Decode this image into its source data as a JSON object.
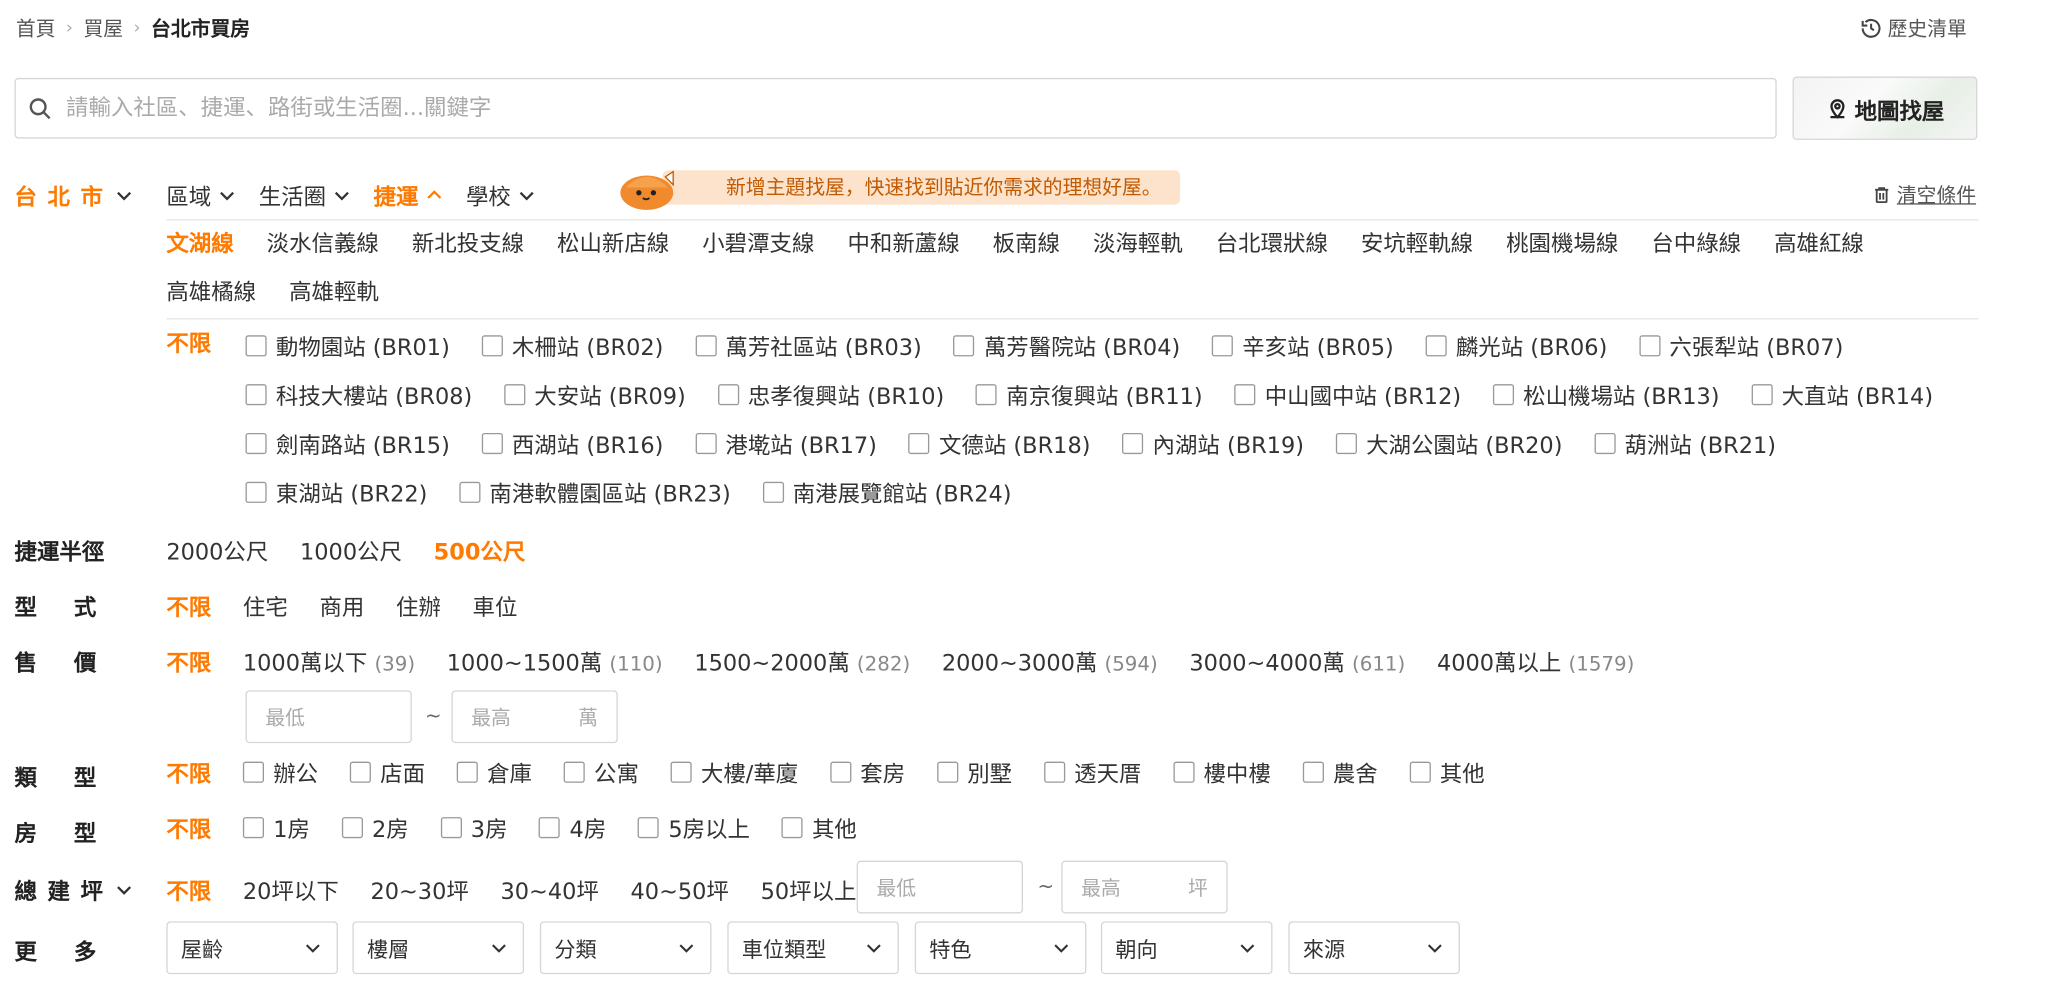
{
  "breadcrumb": {
    "home": "首頁",
    "buy": "買屋",
    "current": "台北市買房"
  },
  "history": {
    "label": "歷史清單"
  },
  "search": {
    "placeholder": "請輸入社區、捷運、路街或生活圈...關鍵字",
    "map_label": "地圖找屋"
  },
  "city": {
    "label": "台北市"
  },
  "tabs": [
    "區域",
    "生活圈",
    "捷運",
    "學校"
  ],
  "promo": {
    "text": "新增主題找屋，快速找到貼近你需求的理想好屋。"
  },
  "clear": {
    "label": "清空條件"
  },
  "lines": [
    "文湖線",
    "淡水信義線",
    "新北投支線",
    "松山新店線",
    "小碧潭支線",
    "中和新蘆線",
    "板南線",
    "淡海輕軌",
    "台北環狀線",
    "安坑輕軌線",
    "桃園機場線",
    "台中綠線",
    "高雄紅線",
    "高雄橘線",
    "高雄輕軌"
  ],
  "stations": {
    "unlimited": "不限",
    "items": [
      "動物園站 (BR01)",
      "木柵站 (BR02)",
      "萬芳社區站 (BR03)",
      "萬芳醫院站 (BR04)",
      "辛亥站 (BR05)",
      "麟光站 (BR06)",
      "六張犁站 (BR07)",
      "科技大樓站 (BR08)",
      "大安站 (BR09)",
      "忠孝復興站 (BR10)",
      "南京復興站 (BR11)",
      "中山國中站 (BR12)",
      "松山機場站 (BR13)",
      "大直站 (BR14)",
      "劍南路站 (BR15)",
      "西湖站 (BR16)",
      "港墘站 (BR17)",
      "文德站 (BR18)",
      "內湖站 (BR19)",
      "大湖公園站 (BR20)",
      "葫洲站 (BR21)",
      "東湖站 (BR22)",
      "南港軟體園區站 (BR23)",
      "南港展覽館站 (BR24)"
    ]
  },
  "radius": {
    "label": "捷運半徑",
    "options": [
      "2000公尺",
      "1000公尺",
      "500公尺"
    ]
  },
  "form": {
    "label": "型式",
    "options": [
      "不限",
      "住宅",
      "商用",
      "住辦",
      "車位"
    ]
  },
  "price": {
    "label": "售價",
    "unlimited": "不限",
    "options": [
      {
        "text": "1000萬以下",
        "count": "(39)"
      },
      {
        "text": "1000~1500萬",
        "count": "(110)"
      },
      {
        "text": "1500~2000萬",
        "count": "(282)"
      },
      {
        "text": "2000~3000萬",
        "count": "(594)"
      },
      {
        "text": "3000~4000萬",
        "count": "(611)"
      },
      {
        "text": "4000萬以上",
        "count": "(1579)"
      }
    ],
    "min_placeholder": "最低",
    "max_placeholder": "最高",
    "unit": "萬",
    "tilde": "~"
  },
  "kind": {
    "label": "類型",
    "unlimited": "不限",
    "options": [
      "辦公",
      "店面",
      "倉庫",
      "公寓",
      "大樓/華廈",
      "套房",
      "別墅",
      "透天厝",
      "樓中樓",
      "農舍",
      "其他"
    ]
  },
  "rooms": {
    "label": "房型",
    "unlimited": "不限",
    "options": [
      "1房",
      "2房",
      "3房",
      "4房",
      "5房以上",
      "其他"
    ]
  },
  "area": {
    "label": "總建坪",
    "options": [
      "不限",
      "20坪以下",
      "20~30坪",
      "30~40坪",
      "40~50坪",
      "50坪以上"
    ],
    "min_placeholder": "最低",
    "max_placeholder": "最高",
    "unit": "坪",
    "tilde": "~"
  },
  "more": {
    "label": "更多",
    "selects": [
      "屋齡",
      "樓層",
      "分類",
      "車位類型",
      "特色",
      "朝向",
      "來源"
    ]
  },
  "colors": {
    "accent": "#ff7a00",
    "promo_bg": "#fde3cc"
  }
}
